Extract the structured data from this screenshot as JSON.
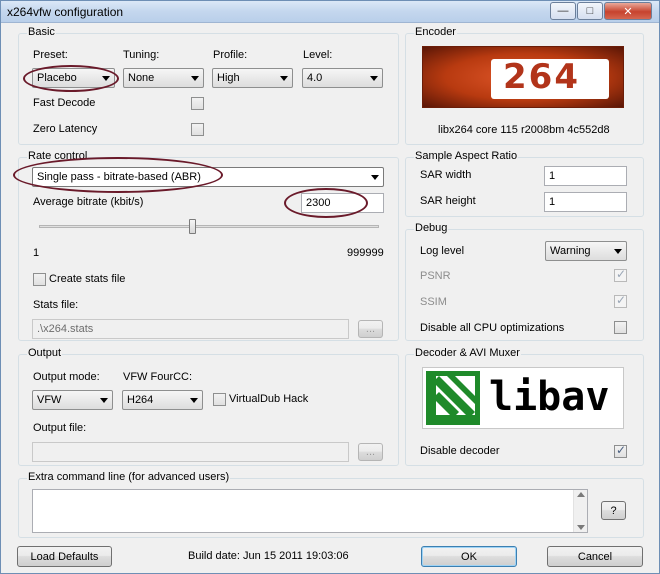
{
  "window": {
    "title": "x264vfw configuration",
    "minimize_glyph": "—",
    "maximize_glyph": "□",
    "close_glyph": "✕"
  },
  "basic": {
    "label": "Basic",
    "preset": {
      "label": "Preset:",
      "value": "Placebo"
    },
    "tuning": {
      "label": "Tuning:",
      "value": "None"
    },
    "profile": {
      "label": "Profile:",
      "value": "High"
    },
    "level": {
      "label": "Level:",
      "value": "4.0"
    },
    "fast_decode": {
      "label": "Fast Decode",
      "checked": false
    },
    "zero_latency": {
      "label": "Zero Latency",
      "checked": false
    }
  },
  "encoder": {
    "label": "Encoder",
    "logo_text": "264",
    "version": "libx264 core 115 r2008bm 4c552d8"
  },
  "rate_control": {
    "label": "Rate control",
    "mode": "Single pass - bitrate-based (ABR)",
    "bitrate_label": "Average bitrate (kbit/s)",
    "bitrate_value": "2300",
    "slider_min": "1",
    "slider_max": "999999",
    "slider_fraction": 0.45,
    "create_stats": {
      "label": "Create stats file",
      "checked": false
    },
    "stats_file_label": "Stats file:",
    "stats_file_value": ".\\x264.stats",
    "browse_label": "..."
  },
  "sar": {
    "label": "Sample Aspect Ratio",
    "width_label": "SAR width",
    "width_value": "1",
    "height_label": "SAR height",
    "height_value": "1"
  },
  "debug": {
    "label": "Debug",
    "log_level_label": "Log level",
    "log_level_value": "Warning",
    "psnr": {
      "label": "PSNR",
      "checked": true
    },
    "ssim": {
      "label": "SSIM",
      "checked": true
    },
    "disable_cpu": {
      "label": "Disable all CPU optimizations",
      "checked": false
    }
  },
  "output": {
    "label": "Output",
    "mode_label": "Output mode:",
    "mode_value": "VFW",
    "fourcc_label": "VFW FourCC:",
    "fourcc_value": "H264",
    "vdub_hack": {
      "label": "VirtualDub Hack",
      "checked": false
    },
    "file_label": "Output file:",
    "file_value": "",
    "browse_label": "..."
  },
  "decoder": {
    "label": "Decoder & AVI Muxer",
    "logo_text": "libav",
    "disable_decoder": {
      "label": "Disable decoder",
      "checked": true
    }
  },
  "extra": {
    "label": "Extra command line (for advanced users)",
    "value": "",
    "help_label": "?"
  },
  "footer": {
    "load_defaults": "Load Defaults",
    "build_date": "Build date: Jun 15 2011 19:03:06",
    "ok": "OK",
    "cancel": "Cancel"
  },
  "colors": {
    "annotation_ellipse": "#6a1a2a",
    "encoder_logo_bg": "#b83a10",
    "libav_green": "#1f8a2a"
  }
}
